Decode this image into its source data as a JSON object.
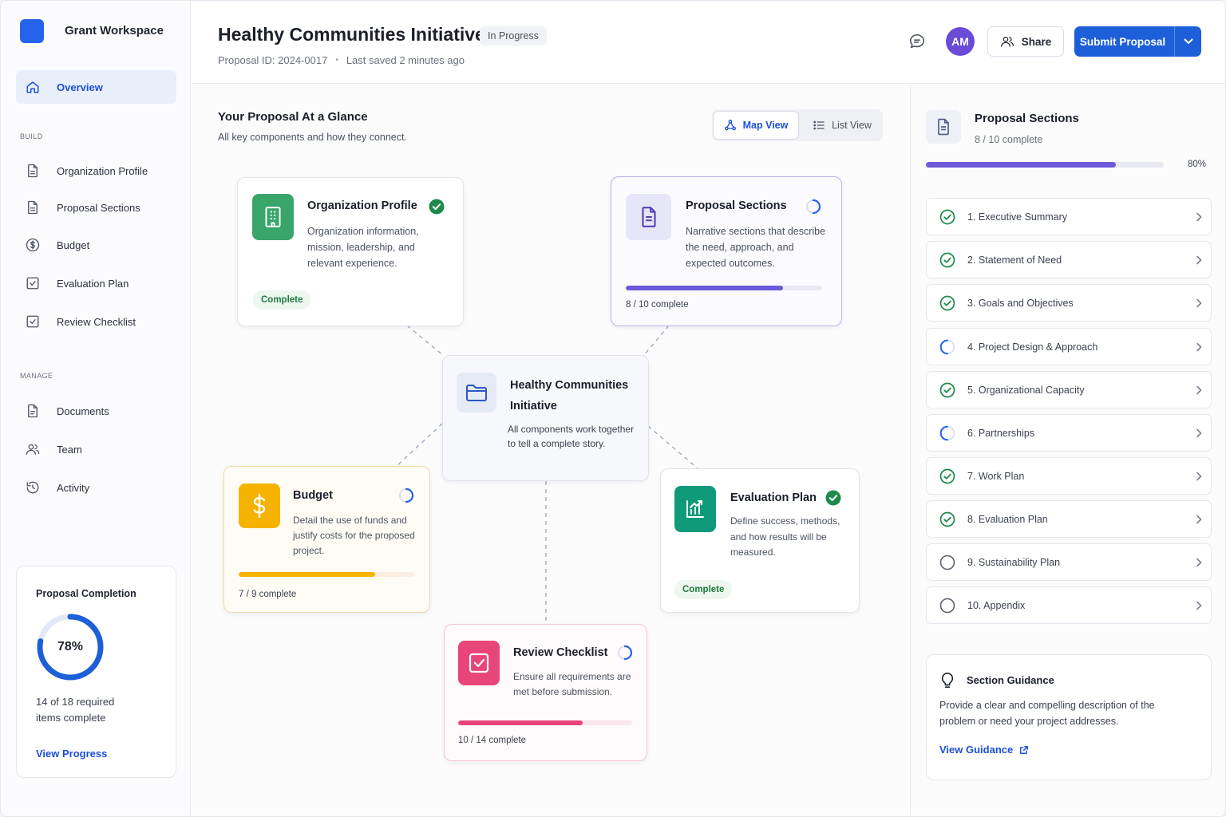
{
  "app": {
    "workspace_name": "Grant Workspace"
  },
  "sidebar": {
    "overview": "Overview",
    "build_label": "BUILD",
    "build_items": [
      {
        "label": "Organization Profile",
        "icon": "document-icon"
      },
      {
        "label": "Proposal Sections",
        "icon": "document-icon"
      },
      {
        "label": "Budget",
        "icon": "dollar-circle-icon"
      },
      {
        "label": "Evaluation Plan",
        "icon": "checkbox-icon"
      },
      {
        "label": "Review Checklist",
        "icon": "checkbox-icon"
      }
    ],
    "manage_label": "MANAGE",
    "manage_items": [
      {
        "label": "Documents",
        "icon": "document-icon"
      },
      {
        "label": "Team",
        "icon": "team-icon"
      },
      {
        "label": "Activity",
        "icon": "activity-icon"
      }
    ],
    "completion": {
      "title": "Proposal Completion",
      "percent": 78,
      "percent_label": "78%",
      "desc": "14 of 18 required items complete",
      "link": "View Progress"
    }
  },
  "header": {
    "title": "Healthy Communities Initiative",
    "status": "In Progress",
    "proposal_id": "Proposal ID: 2024-0017",
    "separator": "•",
    "last_saved": "Last saved 2 minutes ago",
    "avatar_initials": "AM",
    "share": "Share",
    "submit": "Submit Proposal"
  },
  "glance": {
    "title": "Your Proposal At a Glance",
    "subtitle": "All key components and how they connect.",
    "map_view": "Map View",
    "list_view": "List View"
  },
  "cards": {
    "org": {
      "title": "Organization Profile",
      "desc": "Organization information, mission, leadership, and relevant experience.",
      "status": "Complete"
    },
    "sections": {
      "title": "Proposal Sections",
      "desc": "Narrative sections that describe the need, approach, and expected outcomes.",
      "progress": 0.8,
      "progress_text": "8 / 10 complete"
    },
    "center": {
      "title": "Healthy Communities Initiative",
      "desc": "All components work together to tell a complete story."
    },
    "budget": {
      "title": "Budget",
      "desc": "Detail the use of funds and justify costs for the proposed project.",
      "progress": 0.778,
      "progress_text": "7 / 9 complete"
    },
    "evaluation": {
      "title": "Evaluation Plan",
      "desc": "Define success, methods, and how results will be measured.",
      "status": "Complete"
    },
    "review": {
      "title": "Review Checklist",
      "desc": "Ensure all requirements are met before submission.",
      "progress": 0.714,
      "progress_text": "10 / 14 complete"
    }
  },
  "right_panel": {
    "title": "Proposal Sections",
    "subtitle": "8 / 10 complete",
    "progress": 0.8,
    "percent_label": "80%",
    "items": [
      {
        "label": "1. Executive Summary",
        "status": "complete"
      },
      {
        "label": "2. Statement of Need",
        "status": "complete"
      },
      {
        "label": "3. Goals and Objectives",
        "status": "complete"
      },
      {
        "label": "4. Project Design & Approach",
        "status": "in-progress"
      },
      {
        "label": "5. Organizational Capacity",
        "status": "complete"
      },
      {
        "label": "6. Partnerships",
        "status": "in-progress"
      },
      {
        "label": "7. Work Plan",
        "status": "complete"
      },
      {
        "label": "8. Evaluation Plan",
        "status": "complete"
      },
      {
        "label": "9. Sustainability Plan",
        "status": "not-started"
      },
      {
        "label": "10. Appendix",
        "status": "not-started"
      }
    ],
    "guidance": {
      "title": "Section Guidance",
      "text": "Provide a clear and compelling description of the problem or need your project addresses.",
      "link": "View Guidance"
    }
  },
  "colors": {
    "primary": "#1d5fd8",
    "success": "#1f8a4c",
    "purple": "#6b5bd8",
    "amber": "#f5b300",
    "pink": "#e8457a",
    "teal": "#0f9a7a"
  }
}
